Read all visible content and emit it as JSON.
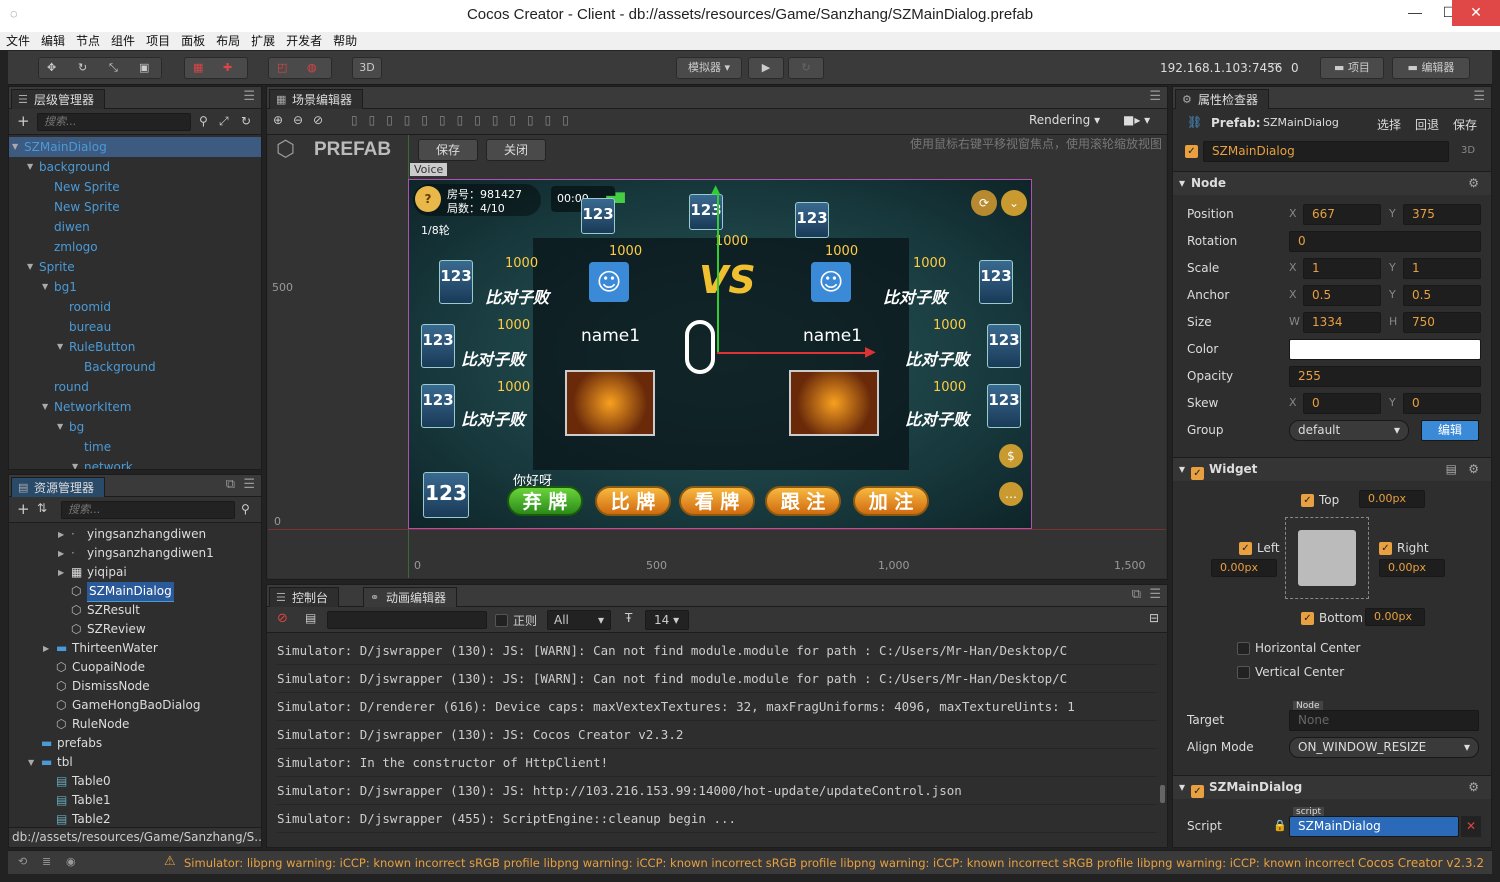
{
  "window": {
    "title": "Cocos Creator - Client - db://assets/resources/Game/Sanzhang/SZMainDialog.prefab"
  },
  "menu": [
    "文件",
    "编辑",
    "节点",
    "组件",
    "项目",
    "面板",
    "布局",
    "扩展",
    "开发者",
    "帮助"
  ],
  "toolbar": {
    "dimension": "3D",
    "simulator": "模拟器 ▾",
    "ip": "192.168.1.103:7456",
    "connected": "0",
    "project": "项目",
    "editor": "编辑器"
  },
  "hierarchy": {
    "title": "层级管理器",
    "search_placeholder": "搜索...",
    "items": [
      {
        "label": "SZMainDialog",
        "depth": 0,
        "arrow": "down"
      },
      {
        "label": "background",
        "depth": 1,
        "arrow": "down"
      },
      {
        "label": "New Sprite",
        "depth": 2,
        "arrow": ""
      },
      {
        "label": "New Sprite",
        "depth": 2,
        "arrow": ""
      },
      {
        "label": "diwen",
        "depth": 2,
        "arrow": ""
      },
      {
        "label": "zmlogo",
        "depth": 2,
        "arrow": ""
      },
      {
        "label": "Sprite",
        "depth": 1,
        "arrow": "down"
      },
      {
        "label": "bg1",
        "depth": 2,
        "arrow": "down"
      },
      {
        "label": "roomid",
        "depth": 3,
        "arrow": ""
      },
      {
        "label": "bureau",
        "depth": 3,
        "arrow": ""
      },
      {
        "label": "RuleButton",
        "depth": 3,
        "arrow": "down"
      },
      {
        "label": "Background",
        "depth": 4,
        "arrow": ""
      },
      {
        "label": "round",
        "depth": 2,
        "arrow": ""
      },
      {
        "label": "NetworkItem",
        "depth": 2,
        "arrow": "down"
      },
      {
        "label": "bg",
        "depth": 3,
        "arrow": "down"
      },
      {
        "label": "time",
        "depth": 4,
        "arrow": ""
      },
      {
        "label": "network",
        "depth": 4,
        "arrow": "down"
      }
    ]
  },
  "assets": {
    "title": "资源管理器",
    "search_placeholder": "搜索...",
    "items": [
      {
        "label": "yingsanzhangdiwen",
        "depth": 4,
        "arrow": "right",
        "icon": "small"
      },
      {
        "label": "yingsanzhangdiwen1",
        "depth": 4,
        "arrow": "right",
        "icon": "small"
      },
      {
        "label": "yiqipai",
        "depth": 4,
        "arrow": "right",
        "icon": "tex"
      },
      {
        "label": "SZMainDialog",
        "depth": 4,
        "arrow": "",
        "icon": "prefab",
        "selected": true
      },
      {
        "label": "SZResult",
        "depth": 4,
        "arrow": "",
        "icon": "prefab"
      },
      {
        "label": "SZReview",
        "depth": 4,
        "arrow": "",
        "icon": "prefab"
      },
      {
        "label": "ThirteenWater",
        "depth": 3,
        "arrow": "right",
        "icon": "folder"
      },
      {
        "label": "CuopaiNode",
        "depth": 3,
        "arrow": "",
        "icon": "prefab"
      },
      {
        "label": "DismissNode",
        "depth": 3,
        "arrow": "",
        "icon": "prefab"
      },
      {
        "label": "GameHongBaoDialog",
        "depth": 3,
        "arrow": "",
        "icon": "prefab"
      },
      {
        "label": "RuleNode",
        "depth": 3,
        "arrow": "",
        "icon": "prefab"
      },
      {
        "label": "prefabs",
        "depth": 2,
        "arrow": "",
        "icon": "folder"
      },
      {
        "label": "tbl",
        "depth": 2,
        "arrow": "down",
        "icon": "folder"
      },
      {
        "label": "Table0",
        "depth": 3,
        "arrow": "",
        "icon": "table"
      },
      {
        "label": "Table1",
        "depth": 3,
        "arrow": "",
        "icon": "table"
      },
      {
        "label": "Table2",
        "depth": 3,
        "arrow": "",
        "icon": "table"
      }
    ],
    "path": "db://assets/resources/Game/Sanzhang/S..."
  },
  "scene": {
    "title": "场景编辑器",
    "rendering": "Rendering",
    "prefab_label": "PREFAB",
    "save": "保存",
    "close": "关闭",
    "hint": "使用鼠标右键平移视窗焦点，使用滚轮缩放视图",
    "voice_label": "Voice",
    "ruler_y": [
      "500",
      "0"
    ],
    "ruler_x": [
      "0",
      "500",
      "1,000",
      "1,500"
    ],
    "game": {
      "room": "房号：981427",
      "rounds": "局数：4/10",
      "turn": "1/8轮",
      "time": "00:00",
      "name_left": "name1",
      "name_right": "name1",
      "chat": "你好呀",
      "bet": "1000",
      "buttons": [
        "弃 牌",
        "比 牌",
        "看 牌",
        "跟 注",
        "加 注"
      ],
      "lose_label": "比对子败"
    }
  },
  "console": {
    "title": "控制台",
    "anim_title": "动画编辑器",
    "regex_label": "正则",
    "level": "All",
    "fontsize": "14",
    "lines": [
      "Simulator: D/jswrapper (130): JS: [WARN]: Can not find module.module for path : C:/Users/Mr-Han/Desktop/C",
      "Simulator: D/jswrapper (130): JS: [WARN]: Can not find module.module for path : C:/Users/Mr-Han/Desktop/C",
      "Simulator: D/renderer (616): Device caps: maxVextexTextures: 32, maxFragUniforms: 4096, maxTextureUints: 1",
      "Simulator: D/jswrapper (130): JS: Cocos Creator v2.3.2",
      "Simulator: In the constructor of HttpClient!",
      "Simulator: D/jswrapper (130): JS: http://103.216.153.99:14000/hot-update/updateControl.json",
      "Simulator: D/jswrapper (455): ScriptEngine::cleanup begin ..."
    ]
  },
  "inspector": {
    "title": "属性检查器",
    "prefab_prefix": "Prefab:",
    "prefab_name": "SZMainDialog",
    "actions": [
      "选择",
      "回退",
      "保存"
    ],
    "node_name": "SZMainDialog",
    "badge_3d": "3D",
    "node_section": "Node",
    "props": {
      "position": {
        "label": "Position",
        "x": "667",
        "y": "375"
      },
      "rotation": {
        "label": "Rotation",
        "v": "0"
      },
      "scale": {
        "label": "Scale",
        "x": "1",
        "y": "1"
      },
      "anchor": {
        "label": "Anchor",
        "x": "0.5",
        "y": "0.5"
      },
      "size": {
        "label": "Size",
        "w": "1334",
        "h": "750"
      },
      "color": {
        "label": "Color",
        "value": "#ffffff"
      },
      "opacity": {
        "label": "Opacity",
        "v": "255"
      },
      "skew": {
        "label": "Skew",
        "x": "0",
        "y": "0"
      },
      "group": {
        "label": "Group",
        "v": "default",
        "edit": "编辑"
      }
    },
    "widget": {
      "title": "Widget",
      "top": "Top",
      "top_v": "0.00px",
      "left": "Left",
      "left_v": "0.00px",
      "right": "Right",
      "right_v": "0.00px",
      "bottom": "Bottom",
      "bottom_v": "0.00px",
      "hcenter": "Horizontal Center",
      "vcenter": "Vertical Center",
      "target_label": "Target",
      "target_tag": "Node",
      "target_v": "None",
      "align_label": "Align Mode",
      "align_v": "ON_WINDOW_RESIZE"
    },
    "script_section": {
      "title": "SZMainDialog",
      "label": "Script",
      "tag": "script",
      "value": "SZMainDialog"
    }
  },
  "status": {
    "message": "Simulator: libpng warning: iCCP: known incorrect sRGB profile libpng warning: iCCP: known incorrect sRGB profile libpng warning: iCCP: known incorrect sRGB profile libpng warning: iCCP: known incorrect sRGB profile",
    "version": "Cocos Creator v2.3.2"
  },
  "colors": {
    "accent": "#e8a040",
    "link": "#4a9ad8",
    "warn": "#e8a040"
  }
}
